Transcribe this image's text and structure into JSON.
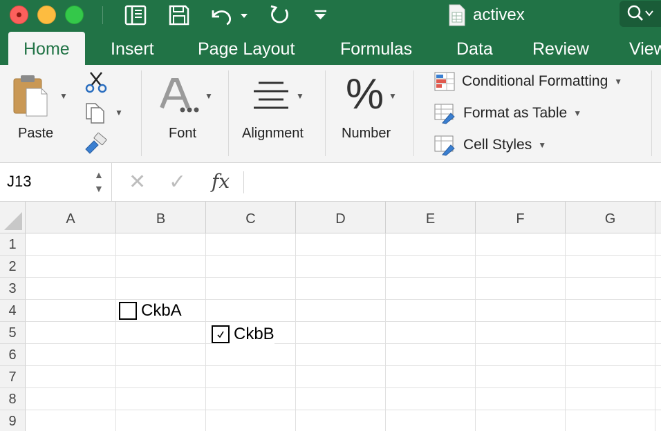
{
  "window": {
    "title": "activex",
    "colors": {
      "brand": "#217346",
      "ribbon": "#f4f4f4"
    }
  },
  "quick_access": [
    "sidebar-icon",
    "save-icon",
    "undo-icon",
    "redo-icon",
    "customize-icon"
  ],
  "ribbon_tabs": [
    {
      "label": "Home",
      "active": true
    },
    {
      "label": "Insert"
    },
    {
      "label": "Page Layout"
    },
    {
      "label": "Formulas"
    },
    {
      "label": "Data"
    },
    {
      "label": "Review"
    },
    {
      "label": "View"
    }
  ],
  "ribbon": {
    "paste": "Paste",
    "font": "Font",
    "alignment": "Alignment",
    "number": "Number",
    "styles": {
      "conditional_formatting": "Conditional Formatting",
      "format_as_table": "Format as Table",
      "cell_styles": "Cell Styles"
    }
  },
  "formula_bar": {
    "name_box": "J13",
    "fx": "fx",
    "formula": ""
  },
  "grid": {
    "columns": [
      "A",
      "B",
      "C",
      "D",
      "E",
      "F",
      "G"
    ],
    "rows": [
      "1",
      "2",
      "3",
      "4",
      "5",
      "6",
      "7",
      "8",
      "9"
    ],
    "controls": [
      {
        "label": "CkbA",
        "checked": false,
        "cell": "B4"
      },
      {
        "label": "CkbB",
        "checked": true,
        "cell": "C5"
      }
    ]
  }
}
